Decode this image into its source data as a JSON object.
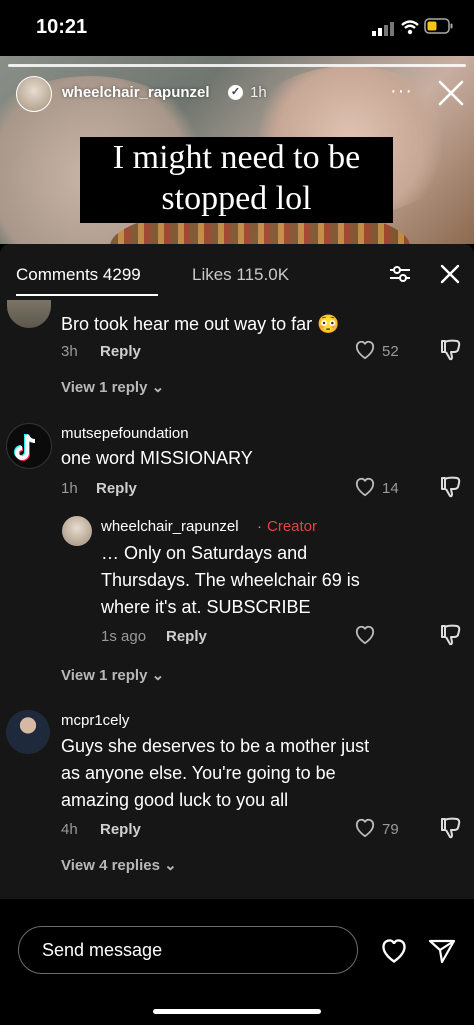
{
  "status_bar": {
    "time": "10:21"
  },
  "story": {
    "username": "wheelchair_rapunzel",
    "time_ago": "1h",
    "more": "···",
    "caption_line1": "I might need to be",
    "caption_line2": "stopped lol"
  },
  "tabs": {
    "comments": "Comments 4299",
    "likes": "Likes 115.0K"
  },
  "comments": [
    {
      "text": "Bro took hear me out way to far 😳",
      "time": "3h",
      "reply": "Reply",
      "likes": "52",
      "view_replies": "View 1 reply"
    },
    {
      "user": "mutsepefoundation",
      "text": "one word MISSIONARY",
      "time": "1h",
      "reply": "Reply",
      "likes": "14",
      "nested": {
        "user": "wheelchair_rapunzel",
        "creator_sep": "·",
        "creator": "Creator",
        "line1": "… Only on Saturdays and",
        "line2": "Thursdays. The wheelchair 69 is",
        "line3": "where it's at. SUBSCRIBE",
        "time": "1s ago",
        "reply": "Reply"
      },
      "view_replies": "View 1 reply"
    },
    {
      "user": "mcpr1cely",
      "line1": "Guys she deserves to be a mother just",
      "line2": "as anyone else. You're going to be",
      "line3": "amazing good luck to you all",
      "time": "4h",
      "reply": "Reply",
      "likes": "79",
      "view_replies": "View 4 replies"
    }
  ],
  "composer": {
    "placeholder": "Send message"
  },
  "colors": {
    "creator": "#e5424a",
    "sheet_bg": "#161616",
    "muted": "#9a9a9a"
  }
}
